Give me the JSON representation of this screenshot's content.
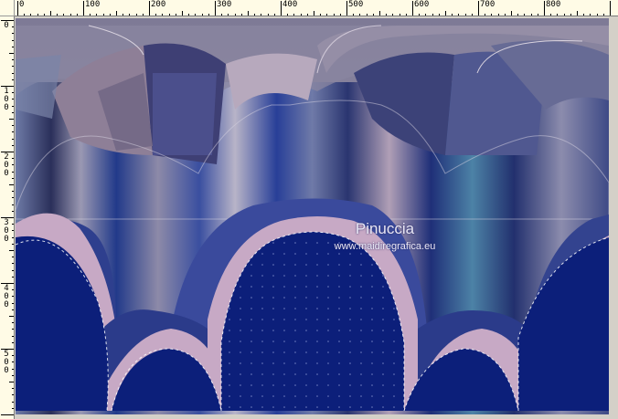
{
  "ruler": {
    "top_labels": [
      "0",
      "100",
      "200",
      "300",
      "400",
      "500",
      "600",
      "700",
      "800"
    ],
    "left_labels": [
      [
        "0"
      ],
      [
        "1",
        "0",
        "0"
      ],
      [
        "2",
        "0",
        "0"
      ],
      [
        "3",
        "0",
        "0"
      ],
      [
        "4",
        "0",
        "0"
      ],
      [
        "5",
        "0",
        "0"
      ]
    ]
  },
  "watermark": {
    "name": "Pinuccia",
    "site": "www.maidiregrafica.eu"
  },
  "colors": {
    "ruler_bg": "#fffbe6",
    "navy": "#0c1f7a",
    "pink": "#c4a6c2",
    "slate": "#8c8aa5"
  }
}
